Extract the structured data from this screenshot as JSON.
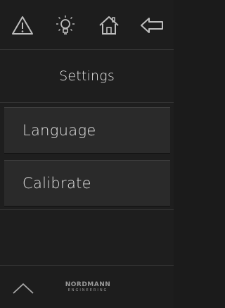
{
  "topbar": {
    "icons": [
      "warning-icon",
      "lightbulb-icon",
      "home-icon",
      "back-arrow-icon"
    ]
  },
  "title": "Settings",
  "menu": {
    "items": [
      {
        "label": "Language"
      },
      {
        "label": "Calibrate"
      }
    ]
  },
  "footer": {
    "logo_brand": "NORDMANN",
    "logo_sub": "ENGINEERING",
    "up_icon": "chevron-up-icon"
  },
  "colors": {
    "background": "#1e1e1e",
    "menu_item": "#2a2a2a",
    "icon_stroke": "#bdbdbd",
    "text": "#e0e0e0"
  }
}
